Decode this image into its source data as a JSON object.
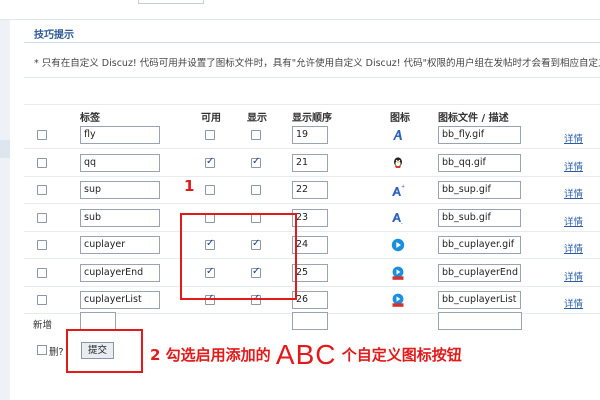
{
  "panel": {
    "title": "技巧提示",
    "notice": "* 只有在自定义 Discuz! 代码可用并设置了图标文件时，具有\"允许使用自定义 Discuz! 代码\"权限的用户组在发帖时才会看到相应自定义 Discuz! 代码按钮"
  },
  "table": {
    "headers": {
      "tag": "标签",
      "enabled": "可用",
      "visible": "显示",
      "order": "显示顺序",
      "icon": "图标",
      "icon_file": "图标文件 / 描述"
    },
    "detail_label": "详情",
    "rows": [
      {
        "tag": "fly",
        "enabled": false,
        "visible": false,
        "order": "19",
        "icon": "fly-icon",
        "icon_file": "bb_fly.gif"
      },
      {
        "tag": "qq",
        "enabled": true,
        "visible": true,
        "order": "21",
        "icon": "qq-icon",
        "icon_file": "bb_qq.gif"
      },
      {
        "tag": "sup",
        "enabled": false,
        "visible": false,
        "order": "22",
        "icon": "sup-icon",
        "icon_file": "bb_sup.gif"
      },
      {
        "tag": "sub",
        "enabled": false,
        "visible": false,
        "order": "23",
        "icon": "sub-icon",
        "icon_file": "bb_sub.gif"
      },
      {
        "tag": "cuplayer",
        "enabled": true,
        "visible": true,
        "order": "24",
        "icon": "play-icon",
        "icon_file": "bb_cuplayer.gif"
      },
      {
        "tag": "cuplayerEnd",
        "enabled": true,
        "visible": true,
        "order": "25",
        "icon": "play-end-icon",
        "icon_file": "bb_cuplayerEnd"
      },
      {
        "tag": "cuplayerList",
        "enabled": true,
        "visible": true,
        "order": "26",
        "icon": "play-list-icon",
        "icon_file": "bb_cuplayerList"
      }
    ]
  },
  "new_row": {
    "label": "新增"
  },
  "footer": {
    "delete_label": "删?",
    "submit_label": "提交"
  },
  "annotations": {
    "step1": "1",
    "step2_prefix": "2 勾选启用添加的",
    "step2_abc": "ABC",
    "step2_suffix": "个自定义图标按钮"
  },
  "colors": {
    "accent": "#2d5b93",
    "link": "#2a5da8",
    "annotation_red": "#e31a1a",
    "check_blue": "#1c3f8c"
  }
}
